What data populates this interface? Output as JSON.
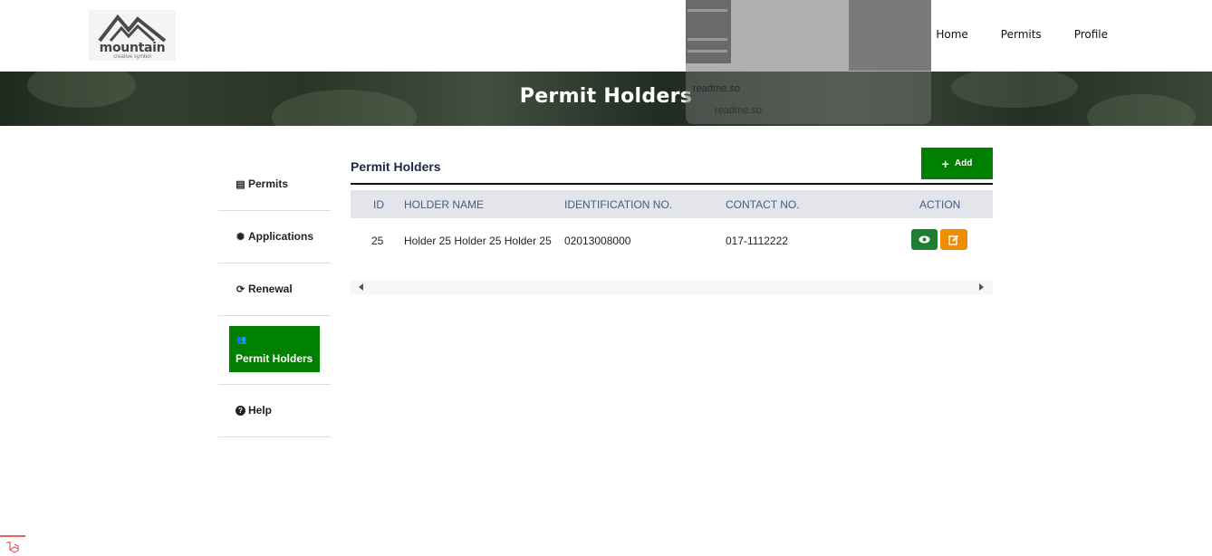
{
  "header": {
    "logo_word": "mountain",
    "logo_tagline": "creative symbol",
    "nav": [
      {
        "label": "Home"
      },
      {
        "label": "Permits"
      },
      {
        "label": "Profile"
      }
    ]
  },
  "banner": {
    "title": "Permit Holders"
  },
  "ghost_overlay": {
    "text_1": "readme.so",
    "text_2": "readme.so"
  },
  "sidebar": {
    "items": [
      {
        "label": "Permits",
        "icon": "file-icon",
        "glyph": "▤"
      },
      {
        "label": "Applications",
        "icon": "gear-icon",
        "glyph": "✺"
      },
      {
        "label": "Renewal",
        "icon": "refresh-icon",
        "glyph": "⟳"
      },
      {
        "label": "Permit Holders",
        "icon": "users-icon",
        "glyph": "👥",
        "active": true
      },
      {
        "label": "Help",
        "icon": "question-icon",
        "glyph": "?"
      }
    ]
  },
  "main": {
    "section_title": "Permit Holders",
    "add_label": "Add",
    "table": {
      "headers": [
        "ID",
        "HOLDER NAME",
        "IDENTIFICATION NO.",
        "CONTACT NO.",
        "ACTION"
      ],
      "rows": [
        {
          "id": "25",
          "holder_name": "Holder 25 Holder 25 Holder 25",
          "identification_no": "02013008000",
          "contact_no": "017-1112222"
        }
      ]
    }
  },
  "colors": {
    "accent_green": "#008000",
    "view_green": "#1e7e34",
    "edit_orange": "#f08c00",
    "header_text": "#3f5d8a"
  }
}
